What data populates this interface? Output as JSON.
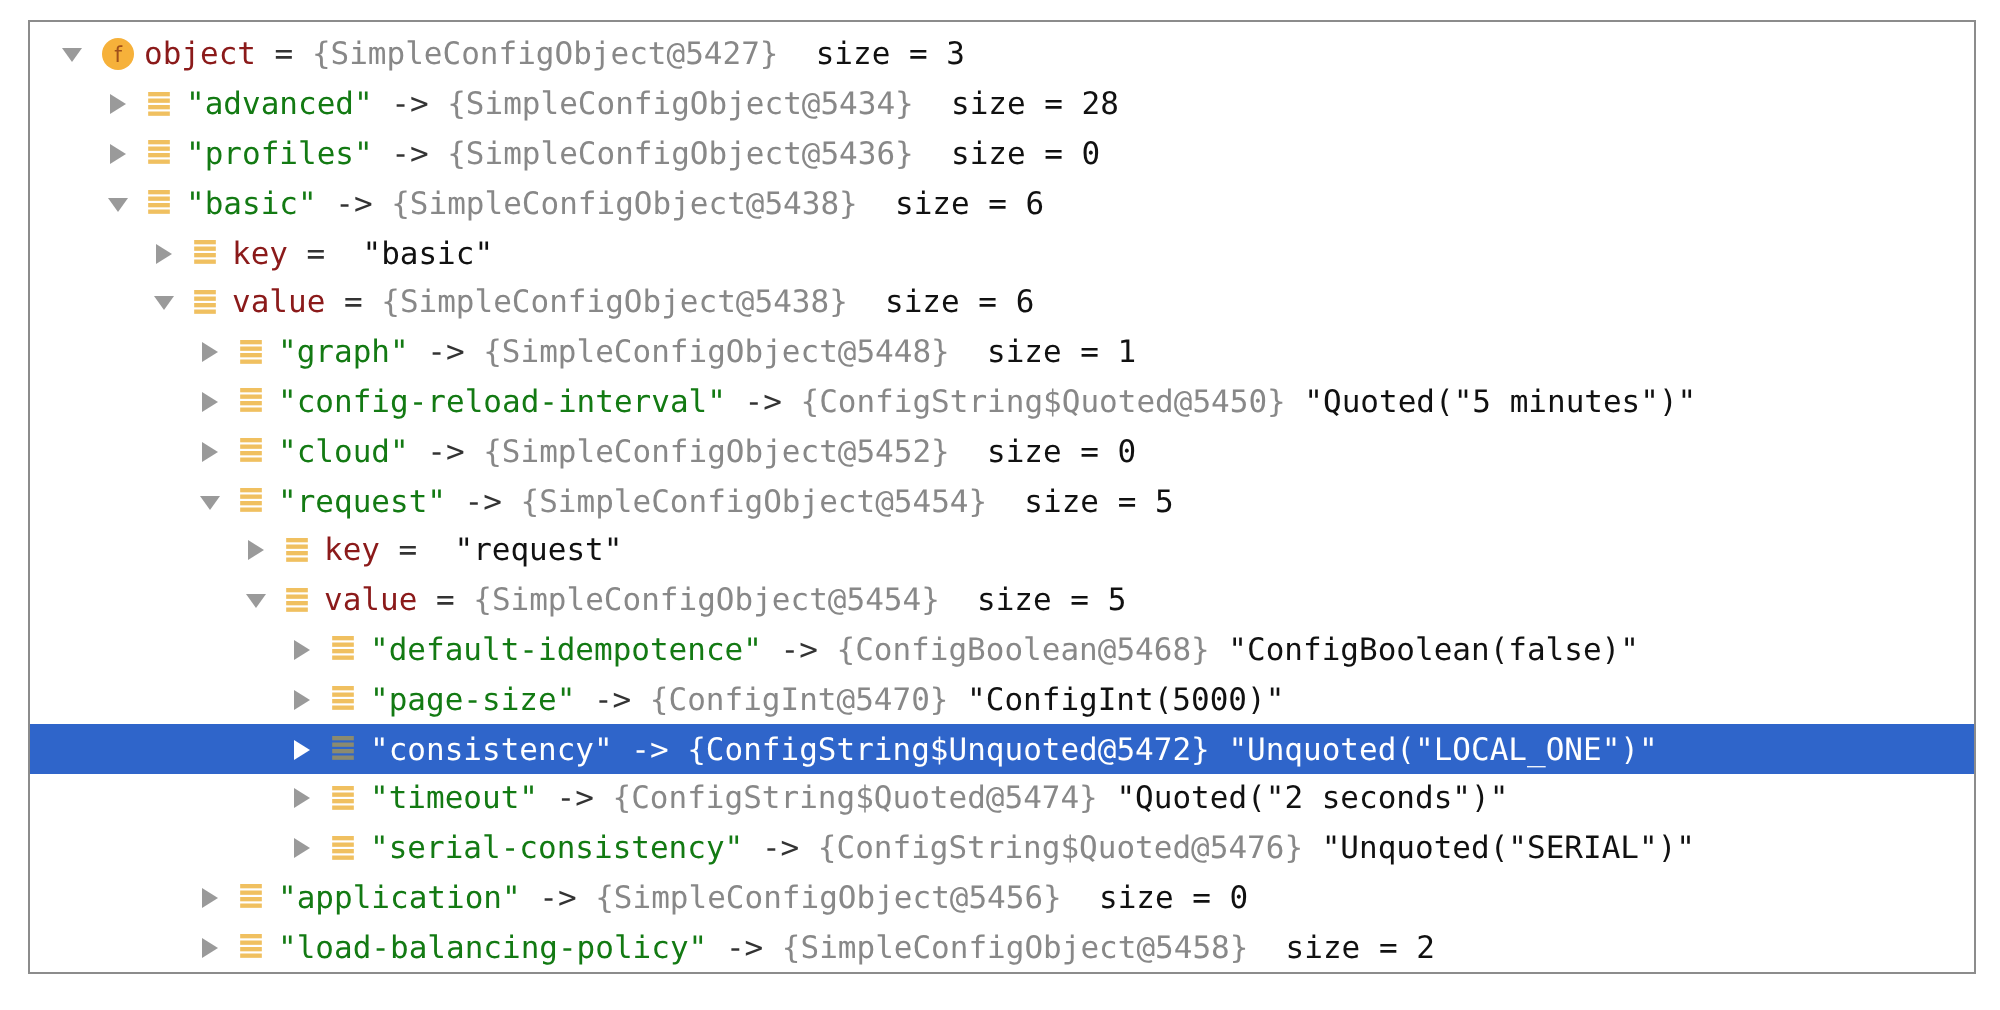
{
  "tree": [
    {
      "kind": "field",
      "badge": "f",
      "name": "object",
      "operator": "=",
      "ref": "{SimpleConfigObject@5427}",
      "detail": "size = 3",
      "expanded": true,
      "selected": false,
      "children": [
        {
          "kind": "entry",
          "name": "\"advanced\"",
          "operator": "->",
          "ref": "{SimpleConfigObject@5434}",
          "detail": "size = 28",
          "expanded": false,
          "selected": false
        },
        {
          "kind": "entry",
          "name": "\"profiles\"",
          "operator": "->",
          "ref": "{SimpleConfigObject@5436}",
          "detail": "size = 0",
          "expanded": false,
          "selected": false
        },
        {
          "kind": "entry",
          "name": "\"basic\"",
          "operator": "->",
          "ref": "{SimpleConfigObject@5438}",
          "detail": "size = 6",
          "expanded": true,
          "selected": false,
          "children": [
            {
              "kind": "member",
              "name": "key",
              "operator": "=",
              "value": "\"basic\"",
              "expanded": false,
              "selected": false
            },
            {
              "kind": "member",
              "name": "value",
              "operator": "=",
              "ref": "{SimpleConfigObject@5438}",
              "detail": "size = 6",
              "expanded": true,
              "selected": false,
              "children": [
                {
                  "kind": "entry",
                  "name": "\"graph\"",
                  "operator": "->",
                  "ref": "{SimpleConfigObject@5448}",
                  "detail": "size = 1",
                  "expanded": false,
                  "selected": false
                },
                {
                  "kind": "entry",
                  "name": "\"config-reload-interval\"",
                  "operator": "->",
                  "ref": "{ConfigString$Quoted@5450}",
                  "value": "\"Quoted(\"5 minutes\")\"",
                  "expanded": false,
                  "selected": false
                },
                {
                  "kind": "entry",
                  "name": "\"cloud\"",
                  "operator": "->",
                  "ref": "{SimpleConfigObject@5452}",
                  "detail": "size = 0",
                  "expanded": false,
                  "selected": false
                },
                {
                  "kind": "entry",
                  "name": "\"request\"",
                  "operator": "->",
                  "ref": "{SimpleConfigObject@5454}",
                  "detail": "size = 5",
                  "expanded": true,
                  "selected": false,
                  "children": [
                    {
                      "kind": "member",
                      "name": "key",
                      "operator": "=",
                      "value": "\"request\"",
                      "expanded": false,
                      "selected": false
                    },
                    {
                      "kind": "member",
                      "name": "value",
                      "operator": "=",
                      "ref": "{SimpleConfigObject@5454}",
                      "detail": "size = 5",
                      "expanded": true,
                      "selected": false,
                      "children": [
                        {
                          "kind": "entry",
                          "name": "\"default-idempotence\"",
                          "operator": "->",
                          "ref": "{ConfigBoolean@5468}",
                          "value": "\"ConfigBoolean(false)\"",
                          "expanded": false,
                          "selected": false
                        },
                        {
                          "kind": "entry",
                          "name": "\"page-size\"",
                          "operator": "->",
                          "ref": "{ConfigInt@5470}",
                          "value": "\"ConfigInt(5000)\"",
                          "expanded": false,
                          "selected": false
                        },
                        {
                          "kind": "entry",
                          "name": "\"consistency\"",
                          "operator": "->",
                          "ref": "{ConfigString$Unquoted@5472}",
                          "value": "\"Unquoted(\"LOCAL_ONE\")\"",
                          "expanded": false,
                          "selected": true
                        },
                        {
                          "kind": "entry",
                          "name": "\"timeout\"",
                          "operator": "->",
                          "ref": "{ConfigString$Quoted@5474}",
                          "value": "\"Quoted(\"2 seconds\")\"",
                          "expanded": false,
                          "selected": false
                        },
                        {
                          "kind": "entry",
                          "name": "\"serial-consistency\"",
                          "operator": "->",
                          "ref": "{ConfigString$Quoted@5476}",
                          "value": "\"Unquoted(\"SERIAL\")\"",
                          "expanded": false,
                          "selected": false
                        }
                      ]
                    }
                  ]
                },
                {
                  "kind": "entry",
                  "name": "\"application\"",
                  "operator": "->",
                  "ref": "{SimpleConfigObject@5456}",
                  "detail": "size = 0",
                  "expanded": false,
                  "selected": false
                },
                {
                  "kind": "entry",
                  "name": "\"load-balancing-policy\"",
                  "operator": "->",
                  "ref": "{SimpleConfigObject@5458}",
                  "detail": "size = 2",
                  "expanded": false,
                  "selected": false
                }
              ]
            }
          ]
        }
      ]
    }
  ]
}
